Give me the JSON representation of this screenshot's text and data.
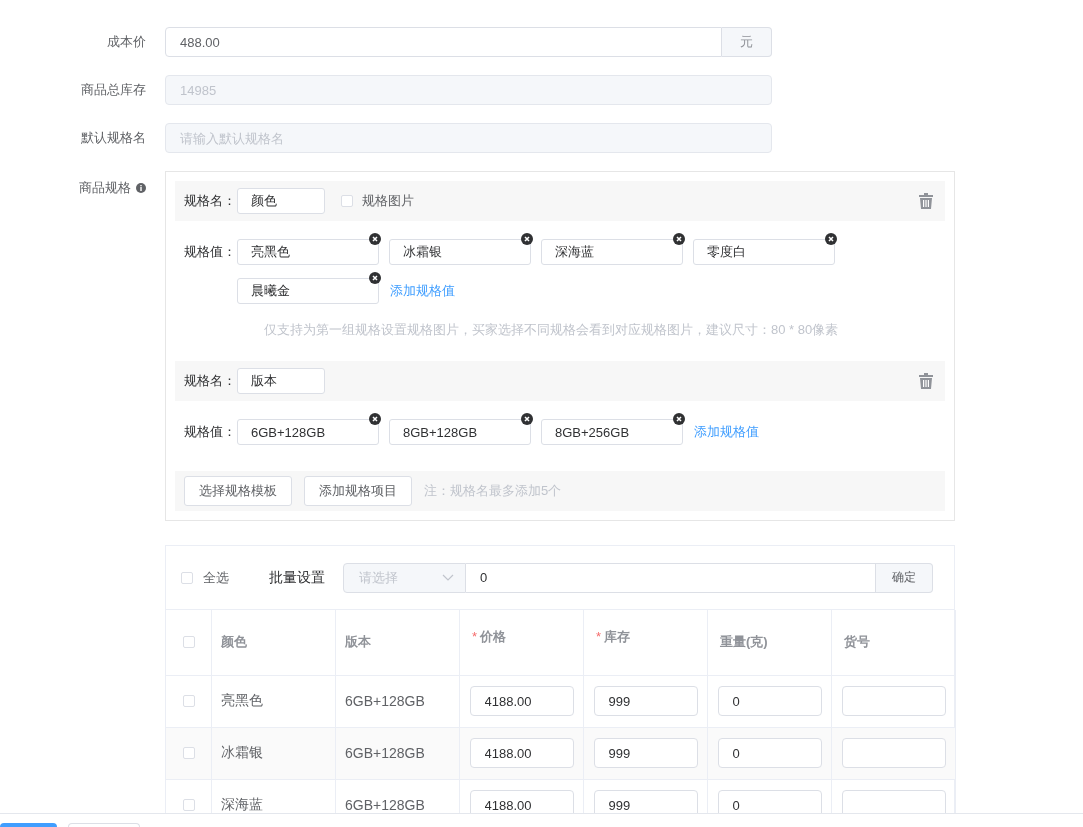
{
  "form_fields": [
    {
      "label": "成本价",
      "value": "488.00",
      "suffix": "元",
      "disabled": false
    },
    {
      "label": "商品总库存",
      "value": "14985",
      "disabled": true
    },
    {
      "label": "默认规格名",
      "placeholder": "请输入默认规格名",
      "disabled": true
    }
  ],
  "specs": {
    "label": "商品规格",
    "info_icon": true,
    "groups": [
      {
        "name_label": "规格名：",
        "name": "颜色",
        "image_option": {
          "label": "规格图片",
          "checked": false
        },
        "values_label": "规格值：",
        "values": [
          "亮黑色",
          "冰霜银",
          "深海蓝",
          "零度白",
          "晨曦金"
        ],
        "add_link": "添加规格值",
        "hint": "仅支持为第一组规格设置规格图片，买家选择不同规格会看到对应规格图片，建议尺寸：80 * 80像素"
      },
      {
        "name_label": "规格名：",
        "name": "版本",
        "values_label": "规格值：",
        "values": [
          "6GB+128GB",
          "8GB+128GB",
          "8GB+256GB"
        ],
        "add_link": "添加规格值"
      }
    ],
    "buttons": [
      "选择规格模板",
      "添加规格项目"
    ],
    "note": "注：规格名最多添加5个"
  },
  "sku_table": {
    "required_mark": "*",
    "select_all": {
      "label": "全选",
      "checked": false
    },
    "batch": {
      "label": "批量设置",
      "select_placeholder": "请选择",
      "value": "0",
      "button": "确定"
    },
    "columns": [
      {
        "kind": "check",
        "checked": false
      },
      {
        "kind": "text",
        "label": "颜色",
        "required": false
      },
      {
        "kind": "text",
        "label": "版本",
        "required": false
      },
      {
        "kind": "input",
        "label": "价格",
        "required": true
      },
      {
        "kind": "input",
        "label": "库存",
        "required": true
      },
      {
        "kind": "input",
        "label": "重量(克)",
        "required": false
      },
      {
        "kind": "input",
        "label": "货号",
        "required": false
      }
    ],
    "rows": [
      {
        "checked": false,
        "highlighted": false,
        "texts": [
          "亮黑色",
          "6GB+128GB"
        ],
        "inputs": [
          "4188.00",
          "999",
          "0"
        ]
      },
      {
        "checked": false,
        "highlighted": true,
        "texts": [
          "冰霜银",
          "6GB+128GB"
        ],
        "inputs": [
          "4188.00",
          "999",
          "0"
        ]
      },
      {
        "checked": false,
        "highlighted": false,
        "texts": [
          "深海蓝",
          "6GB+128GB"
        ],
        "inputs": [
          "4188.00",
          "999",
          "0"
        ]
      }
    ]
  },
  "footer": {
    "buttons": [
      {
        "kind": "primary"
      },
      {
        "kind": "default"
      }
    ]
  }
}
